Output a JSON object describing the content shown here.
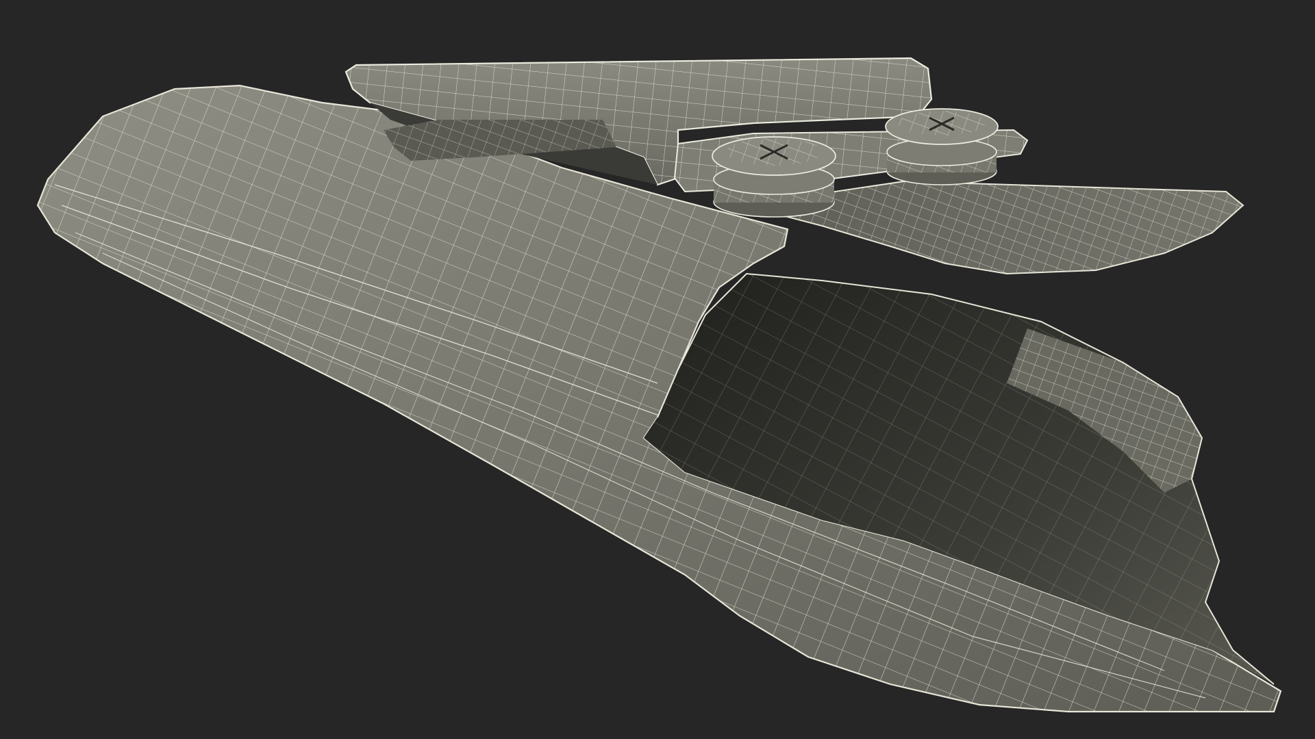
{
  "scene": {
    "background_color": "#262626",
    "surface_color": "#6f6f66",
    "surface_light_color": "#8a8a80",
    "surface_dark_color": "#4a4a44",
    "cavity_color": "#2c2d29",
    "wire_color": "#e8e6d8"
  }
}
